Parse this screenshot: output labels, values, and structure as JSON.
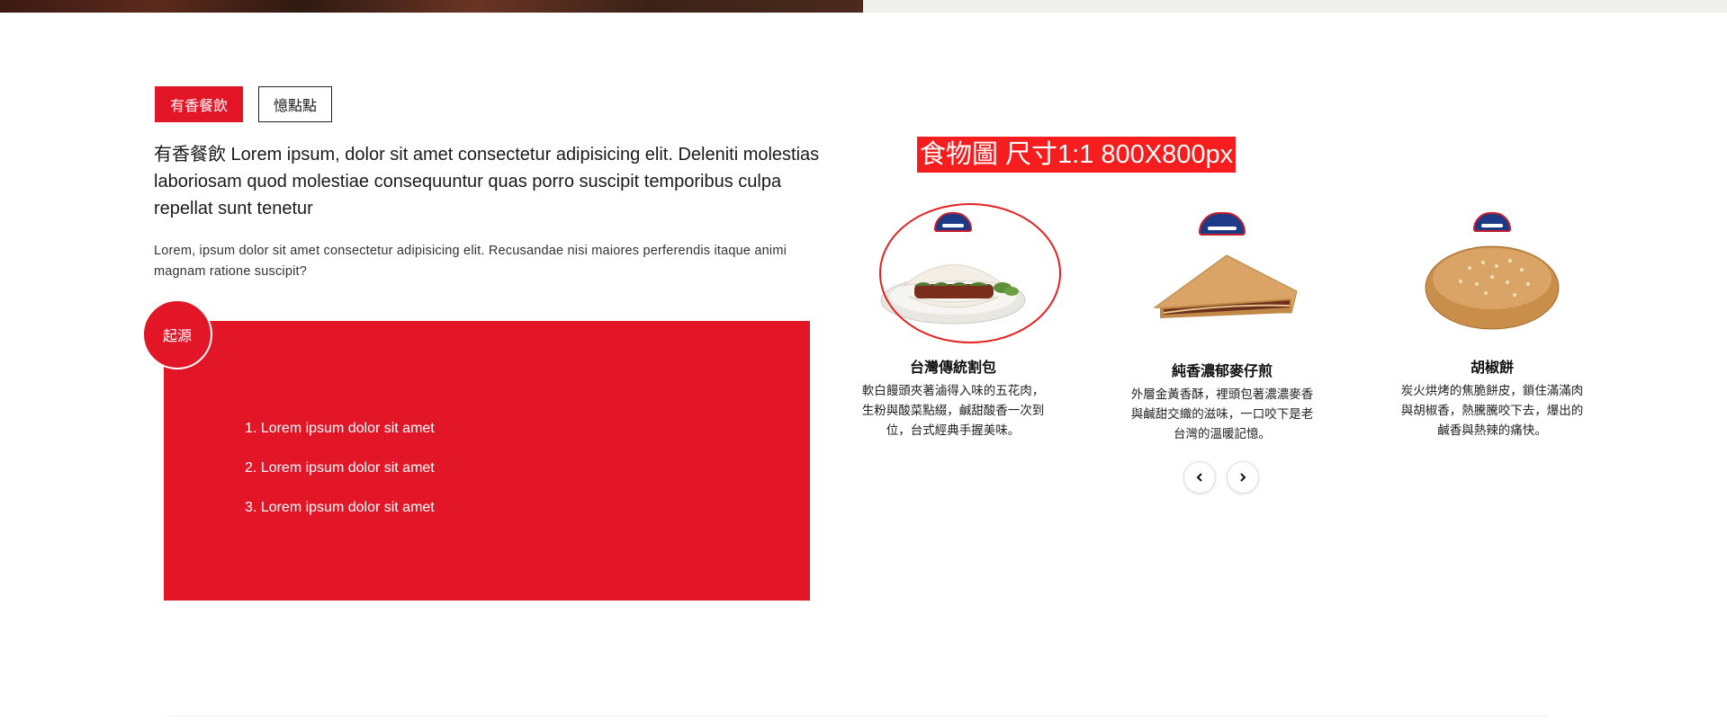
{
  "tabs": [
    {
      "label": "有香餐飲",
      "active": true
    },
    {
      "label": "憶點點",
      "active": false
    }
  ],
  "intro": {
    "headline": "有香餐飲 Lorem ipsum, dolor sit amet consectetur adipisicing elit. Deleniti molestias laboriosam quod molestiae consequuntur quas porro suscipit temporibus culpa repellat sunt tenetur",
    "body": "Lorem, ipsum dolor sit amet consectetur adipisicing elit. Recusandae nisi maiores perferendis itaque animi magnam ratione suscipit?"
  },
  "origin": {
    "badge": "起源",
    "items": [
      "1. Lorem ipsum dolor sit amet",
      "2. Lorem ipsum dolor sit amet",
      "3. Lorem ipsum dolor sit amet"
    ]
  },
  "placeholder_label": "食物圖 尺寸1:1  800X800px",
  "cards": [
    {
      "title": "台灣傳統割包",
      "desc": "軟白饅頭夾著滷得入味的五花肉，生粉與酸菜點綴，鹹甜酸香一次到位，台式經典手握美味。"
    },
    {
      "title": "純香濃郁麥仔煎",
      "desc": "外層金黃香酥，裡頭包著濃濃麥香與鹹甜交織的滋味，一口咬下是老台灣的溫暖記憶。"
    },
    {
      "title": "胡椒餅",
      "desc": "炭火烘烤的焦脆餅皮，鎖住滿滿肉與胡椒香，熱騰騰咬下去，爆出的鹹香與熱辣的痛快。"
    }
  ],
  "colors": {
    "brand_red": "#e31628",
    "label_red": "#f51d1d",
    "logo_navy": "#1d3a86"
  },
  "icons": {
    "prev": "chevron-left-icon",
    "next": "chevron-right-icon"
  }
}
